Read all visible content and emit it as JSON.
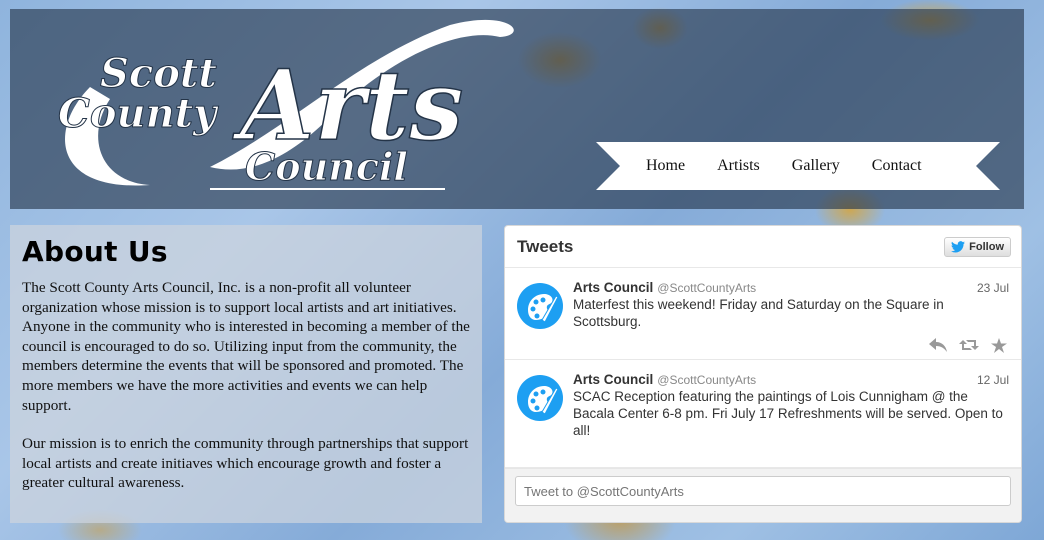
{
  "header": {
    "logo": {
      "line1": "Scott",
      "line2": "County",
      "line3": "Arts",
      "line4": "Council"
    },
    "nav": [
      "Home",
      "Artists",
      "Gallery",
      "Contact"
    ]
  },
  "about": {
    "title": "About Us",
    "paragraphs": [
      "The Scott County Arts Council, Inc. is a non-profit all volunteer organization whose mission is to support local artists and art initiatives. Anyone in the community who is interested in becoming a member of the council is encouraged to do so. Utilizing input from the community, the members determine the events that will be sponsored and promoted. The more members we have the more activities and events we can help support.",
      "Our mission is to enrich the community through partnerships that support local artists and create initiaves which encourage growth and foster a greater cultural awareness."
    ]
  },
  "tweets": {
    "title": "Tweets",
    "follow_label": "Follow",
    "items": [
      {
        "name": "Arts Council",
        "handle": "@ScottCountyArts",
        "date": "23 Jul",
        "text": "Materfest this weekend! Friday and Saturday on the Square in Scottsburg."
      },
      {
        "name": "Arts Council",
        "handle": "@ScottCountyArts",
        "date": "12 Jul",
        "text": "SCAC Reception featuring the paintings of Lois Cunnigham @ the Bacala Center 6-8 pm. Fri July 17  Refreshments will be served. Open to all!"
      }
    ],
    "compose_placeholder": "Tweet to @ScottCountyArts"
  },
  "colors": {
    "twitter_blue": "#1d9ff2",
    "header_overlay": "#243448",
    "background": "#9fc0e4"
  },
  "icons": {
    "avatar": "palette-icon",
    "follow": "twitter-bird-icon",
    "actions": [
      "reply-icon",
      "retweet-icon",
      "favorite-icon"
    ]
  }
}
